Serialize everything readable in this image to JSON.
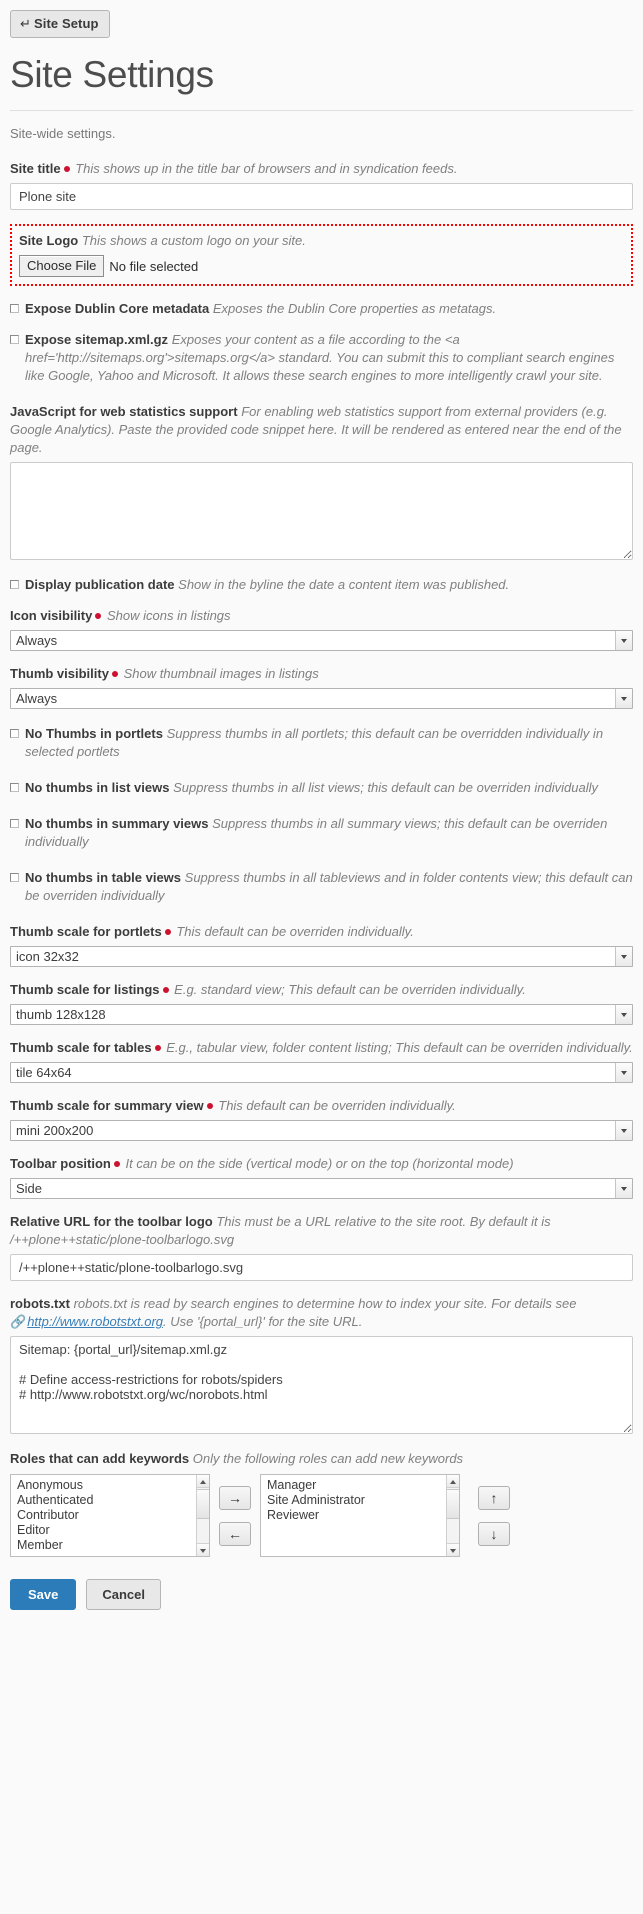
{
  "toolbar": {
    "back_button": "Site Setup",
    "back_icon_glyph": "↵"
  },
  "header": {
    "title": "Site Settings",
    "description": "Site-wide settings."
  },
  "fields": {
    "site_title": {
      "label": "Site title",
      "required": true,
      "hint": "This shows up in the title bar of browsers and in syndication feeds.",
      "value": "Plone site"
    },
    "site_logo": {
      "label": "Site Logo",
      "required": false,
      "hint": "This shows a custom logo on your site.",
      "choose_file_label": "Choose File",
      "no_file_text": "No file selected",
      "highlight_color": "#ff0000"
    },
    "expose_dublin_core": {
      "label": "Expose Dublin Core metadata",
      "hint": "Exposes the Dublin Core properties as metatags.",
      "checked": false
    },
    "expose_sitemap": {
      "label": "Expose sitemap.xml.gz",
      "hint": "Exposes your content as a file according to the <a href='http://sitemaps.org'>sitemaps.org</a> standard. You can submit this to compliant search engines like Google, Yahoo and Microsoft. It allows these search engines to more intelligently crawl your site.",
      "checked": false
    },
    "webstats_js": {
      "label": "JavaScript for web statistics support",
      "hint": "For enabling web statistics support from external providers (e.g. Google Analytics). Paste the provided code snippet here. It will be rendered as entered near the end of the page.",
      "value": ""
    },
    "display_publication_date": {
      "label": "Display publication date",
      "hint": "Show in the byline the date a content item was published.",
      "checked": false
    },
    "icon_visibility": {
      "label": "Icon visibility",
      "required": true,
      "hint": "Show icons in listings",
      "value": "Always",
      "options": [
        "Always"
      ]
    },
    "thumb_visibility": {
      "label": "Thumb visibility",
      "required": true,
      "hint": "Show thumbnail images in listings",
      "value": "Always",
      "options": [
        "Always"
      ]
    },
    "no_thumbs_portlets": {
      "label": "No Thumbs in portlets",
      "hint": "Suppress thumbs in all portlets; this default can be overridden individually in selected portlets",
      "checked": false
    },
    "no_thumbs_lists": {
      "label": "No thumbs in list views",
      "hint": "Suppress thumbs in all list views; this default can be overriden individually",
      "checked": false
    },
    "no_thumbs_summary": {
      "label": "No thumbs in summary views",
      "hint": "Suppress thumbs in all summary views; this default can be overriden individually",
      "checked": false
    },
    "no_thumbs_tables": {
      "label": "No thumbs in table views",
      "hint": "Suppress thumbs in all tableviews and in folder contents view; this default can be overriden individually",
      "checked": false
    },
    "thumb_scale_portlets": {
      "label": "Thumb scale for portlets",
      "required": true,
      "hint": "This default can be overriden individually.",
      "value": "icon 32x32",
      "options": [
        "icon 32x32"
      ]
    },
    "thumb_scale_listings": {
      "label": "Thumb scale for listings",
      "required": true,
      "hint": "E.g. standard view; This default can be overriden individually.",
      "value": "thumb 128x128",
      "options": [
        "thumb 128x128"
      ]
    },
    "thumb_scale_tables": {
      "label": "Thumb scale for tables",
      "required": true,
      "hint": "E.g., tabular view, folder content listing; This default can be overriden individually.",
      "value": "tile 64x64",
      "options": [
        "tile 64x64"
      ]
    },
    "thumb_scale_summary": {
      "label": "Thumb scale for summary view",
      "required": true,
      "hint": "This default can be overriden individually.",
      "value": "mini 200x200",
      "options": [
        "mini 200x200"
      ]
    },
    "toolbar_position": {
      "label": "Toolbar position",
      "required": true,
      "hint": "It can be on the side (vertical mode) or on the top (horizontal mode)",
      "value": "Side",
      "options": [
        "Side"
      ]
    },
    "toolbar_logo": {
      "label": "Relative URL for the toolbar logo",
      "hint": "This must be a URL relative to the site root. By default it is /++plone++static/plone-toolbarlogo.svg",
      "value": "/++plone++static/plone-toolbarlogo.svg"
    },
    "robots_txt": {
      "label": "robots.txt",
      "hint_before_link": "robots.txt is read by search engines to determine how to index your site. For details see ",
      "link_text": "http://www.robotstxt.org",
      "link_icon_glyph": "🔗",
      "hint_after_link": ". Use '{portal_url}' for the site URL.",
      "value": "Sitemap: {portal_url}/sitemap.xml.gz\n\n# Define access-restrictions for robots/spiders\n# http://www.robotstxt.org/wc/norobots.html"
    },
    "keyword_roles": {
      "label": "Roles that can add keywords",
      "hint": "Only the following roles can add new keywords",
      "available": [
        "Anonymous",
        "Authenticated",
        "Contributor",
        "Editor",
        "Member"
      ],
      "selected": [
        "Manager",
        "Site Administrator",
        "Reviewer"
      ],
      "add_button": "→",
      "remove_button": "←",
      "up_button": "↑",
      "down_button": "↓"
    }
  },
  "actions": {
    "save": "Save",
    "cancel": "Cancel",
    "save_color": "#2b7cb9"
  }
}
